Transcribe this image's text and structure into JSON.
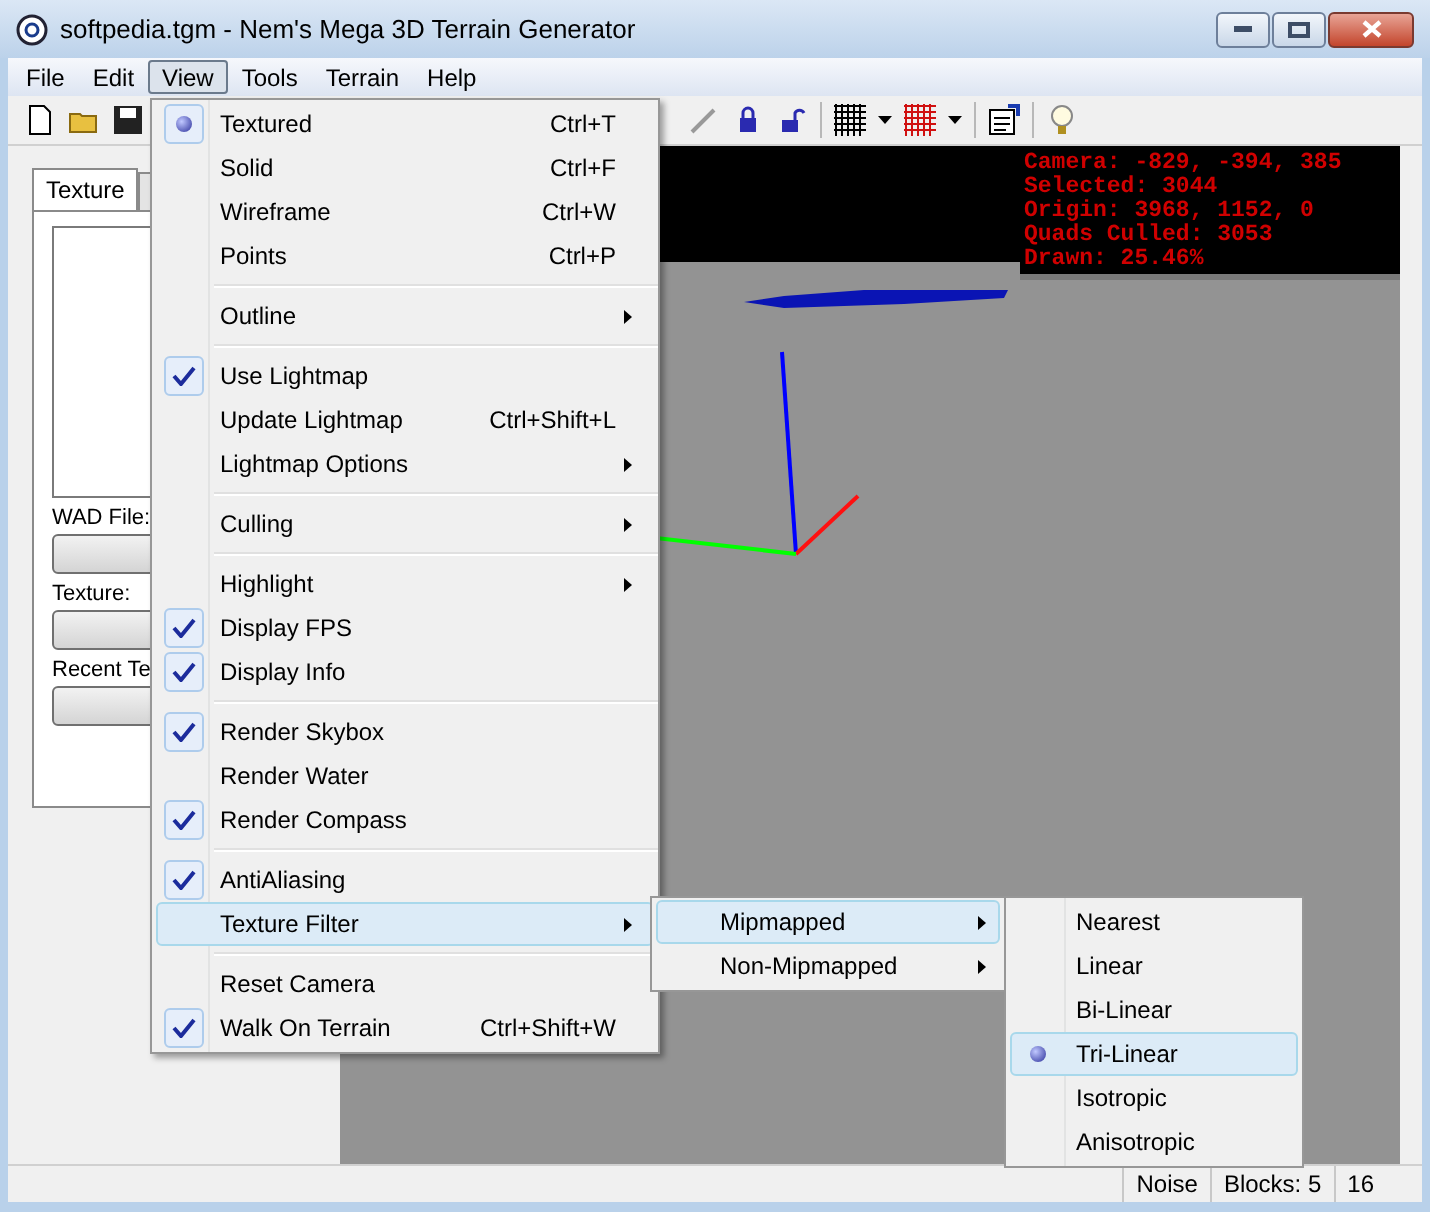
{
  "window": {
    "title": "softpedia.tgm - Nem's Mega 3D Terrain Generator"
  },
  "menu_bar": [
    {
      "label": "File",
      "selected": false
    },
    {
      "label": "Edit",
      "selected": false
    },
    {
      "label": "View",
      "selected": true
    },
    {
      "label": "Tools",
      "selected": false
    },
    {
      "label": "Terrain",
      "selected": false
    },
    {
      "label": "Help",
      "selected": false
    }
  ],
  "side_panel": {
    "tab": {
      "label": "Texture",
      "selected": true
    },
    "labels": [
      "WAD File:",
      "Texture:",
      "Recent Te"
    ]
  },
  "viewport": {
    "info_lines": [
      "Camera: -829, -394, 385",
      "Selected: 3044",
      "Origin: 3968, 1152, 0",
      "Quads Culled: 3053",
      "Drawn: 25.46%"
    ]
  },
  "view_menu": {
    "groups": [
      [
        {
          "kind": "radio",
          "label": "Textured",
          "shortcut": "Ctrl+T",
          "selected": true
        },
        {
          "kind": "radio",
          "label": "Solid",
          "shortcut": "Ctrl+F",
          "selected": false
        },
        {
          "kind": "radio",
          "label": "Wireframe",
          "shortcut": "Ctrl+W",
          "selected": false
        },
        {
          "kind": "radio",
          "label": "Points",
          "shortcut": "Ctrl+P",
          "selected": false
        }
      ],
      [
        {
          "kind": "submenu",
          "label": "Outline",
          "selected": false
        }
      ],
      [
        {
          "kind": "check",
          "label": "Use Lightmap",
          "checked": true
        },
        {
          "kind": "command",
          "label": "Update Lightmap",
          "shortcut": "Ctrl+Shift+L"
        },
        {
          "kind": "submenu",
          "label": "Lightmap Options",
          "selected": false
        }
      ],
      [
        {
          "kind": "submenu",
          "label": "Culling",
          "selected": false
        }
      ],
      [
        {
          "kind": "submenu",
          "label": "Highlight",
          "selected": false
        },
        {
          "kind": "check",
          "label": "Display FPS",
          "checked": true
        },
        {
          "kind": "check",
          "label": "Display Info",
          "checked": true
        }
      ],
      [
        {
          "kind": "check",
          "label": "Render Skybox",
          "checked": true
        },
        {
          "kind": "check",
          "label": "Render Water",
          "checked": false
        },
        {
          "kind": "check",
          "label": "Render Compass",
          "checked": true
        }
      ],
      [
        {
          "kind": "check",
          "label": "AntiAliasing",
          "checked": true
        },
        {
          "kind": "submenu",
          "label": "Texture Filter",
          "selected": true
        }
      ],
      [
        {
          "kind": "command",
          "label": "Reset Camera"
        },
        {
          "kind": "check",
          "label": "Walk On Terrain",
          "checked": true,
          "shortcut": "Ctrl+Shift+W"
        }
      ]
    ]
  },
  "texture_filter_menu": [
    {
      "label": "Mipmapped",
      "selected": true
    },
    {
      "label": "Non-Mipmapped",
      "selected": false
    }
  ],
  "mipmapped_menu": [
    {
      "label": "Nearest",
      "selected": false
    },
    {
      "label": "Linear",
      "selected": false
    },
    {
      "label": "Bi-Linear",
      "selected": false
    },
    {
      "label": "Tri-Linear",
      "selected": true
    },
    {
      "label": "Isotropic",
      "selected": false
    },
    {
      "label": "Anisotropic",
      "selected": false
    }
  ],
  "status_bar": [
    "Noise",
    "Blocks: 5",
    "16"
  ]
}
